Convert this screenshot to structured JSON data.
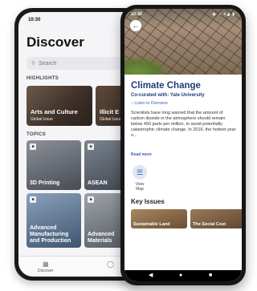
{
  "back_phone": {
    "status_time": "10:30",
    "title": "Discover",
    "search_placeholder": "Search",
    "highlights_label": "HIGHLIGHTS",
    "highlights": [
      {
        "name": "Arts and Culture",
        "sub": "Global Issue"
      },
      {
        "name": "Illicit E",
        "sub": "Global Issue"
      }
    ],
    "topics_label": "TOPICS",
    "topics": [
      {
        "name": "3D Printing",
        "color": "#5a5f66"
      },
      {
        "name": "ASEAN",
        "color": "#4e5560"
      },
      {
        "name": "Advanced Manufacturing and Production",
        "color": "#4b6078"
      },
      {
        "name": "Advanced Materials",
        "color": "#6a6e75"
      }
    ],
    "tabs": [
      {
        "label": "Discover",
        "icon": "grid-icon"
      },
      {
        "label": "",
        "icon": "profile-icon"
      }
    ]
  },
  "front_phone": {
    "status_time": "10:30",
    "status_icons": "◉ ◑ ▾◢ ▮",
    "title": "Climate Change",
    "curated_by": "Co-curated with: Yale University",
    "listen_label": "Listen to Overview",
    "body": "Scientists have long warned that the amount of carbon dioxide in the atmosphere should remain below 450 parts per million, to avoid potentially catastrophic climate change. In 2016, the hottest year o...",
    "read_more": "Read more",
    "view_map": "View Map",
    "key_issues_label": "Key Issues",
    "issues": [
      {
        "name": "Sustainable Land",
        "color": "#8a6a4a"
      },
      {
        "name": "The Social Cost",
        "color": "#7d5c3c"
      }
    ]
  },
  "colors": {
    "accent": "#1f3d7a",
    "link": "#3a5fb0"
  }
}
